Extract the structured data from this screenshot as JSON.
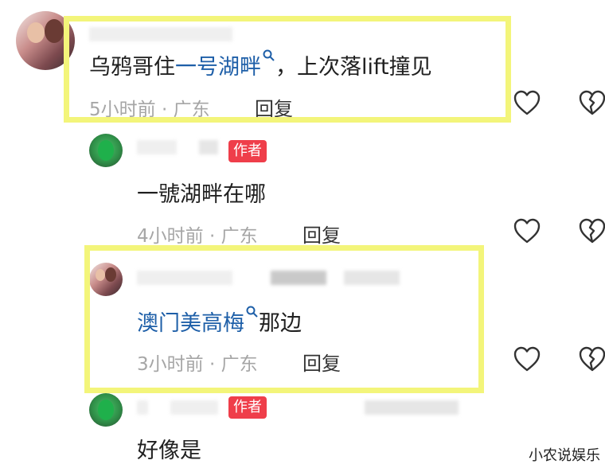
{
  "comments": [
    {
      "text_plain": "乌鸦哥住",
      "text_link": "一号湖畔",
      "text_tail": "，上次落lift撞见",
      "time": "5小时前 · 广东",
      "reply": "回复"
    },
    {
      "author_tag": "作者",
      "text_plain": "一號湖畔在哪",
      "time": "4小时前 · 广东",
      "reply": "回复"
    },
    {
      "text_link": "澳门美高梅",
      "text_tail": "那边",
      "time": "3小时前 · 广东",
      "reply": "回复"
    },
    {
      "author_tag": "作者",
      "text_plain": "好像是"
    }
  ],
  "icons": {
    "like": "heart-outline-icon",
    "dislike": "broken-heart-icon",
    "search": "search-icon"
  },
  "colors": {
    "highlight_box": "#f3f57a",
    "link": "#1e5fa8",
    "author_tag": "#ef3e4a",
    "meta": "#a6a6a6"
  },
  "watermark": "小农说娱乐"
}
